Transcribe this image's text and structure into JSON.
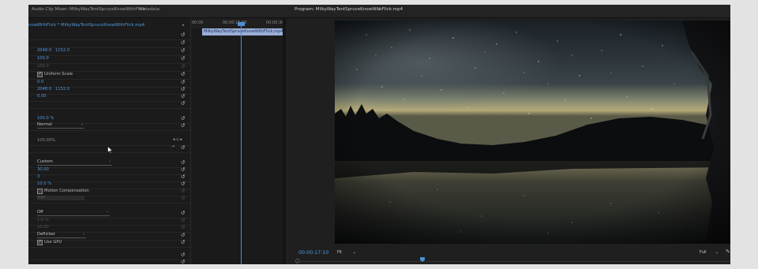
{
  "tabs": {
    "audio_clip_mixer": "Audio Clip Mixer: MilkyWayTentSpruceKnowWithFlick",
    "metadata": "Metadata",
    "program": "Program: MilkyWayTentSpruceKnowWithFlick.mp4"
  },
  "effect_controls": {
    "clip_name": "nowWithFlick * MilkyWayTentSpruceKnowWithFlick.mp4",
    "position_x": "2048.0",
    "position_y": "1152.0",
    "scale": "100.0",
    "scale_width": "100.0",
    "uniform_scale_label": "Uniform Scale",
    "rotation": "0.0",
    "anchor_x": "2048.0",
    "anchor_y": "1152.0",
    "anti_flicker": "0.00",
    "opacity": "100.0 %",
    "blend_mode": "Normal",
    "speed": "100.00%",
    "interpolation": "Custom",
    "value_a": "30.00",
    "value_b": "3",
    "value_c": "10.0 %",
    "motion_compensation_label": "Motion Compensation",
    "blank_field": "Auto",
    "dropdown_off": "Off",
    "value_d": "1.0 %",
    "value_e": "10.00",
    "deflicker": "Deflicker",
    "use_gpu_label": "Use GPU"
  },
  "timeline": {
    "time_start": "00:00",
    "time_mid": "00:00:15:00",
    "time_end": "00:00:30",
    "clip_label": "MilkyWayTentSpruceKnowWithFlick.mp4"
  },
  "program_monitor": {
    "timecode": "00:00:17:10",
    "fit": "Fit",
    "resolution": "Full"
  },
  "colors": {
    "accent_blue": "#4f9ae0",
    "panel_bg": "#1d1d1d",
    "clip_bar": "#9aaed8"
  }
}
